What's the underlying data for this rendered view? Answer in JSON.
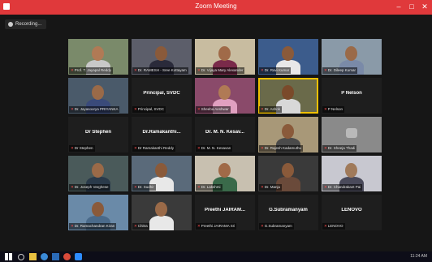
{
  "window": {
    "title": "Zoom Meeting"
  },
  "recording": {
    "label": "Recording..."
  },
  "tiles": [
    {
      "name": "Prof. T. Jayapal Reddy",
      "type": "video",
      "bg": "#7a8a6a",
      "skin": "#b07a55",
      "shirt": "#c8c8c8"
    },
    {
      "name": "Dr. RAMESH - Sree Kottayam",
      "type": "video",
      "bg": "#5c5e6a",
      "skin": "#8a5a3a",
      "shirt": "#2a2a3a"
    },
    {
      "name": "Dr. Vijaya Mary Alexander",
      "type": "video",
      "bg": "#c8bca0",
      "skin": "#a06a48",
      "shirt": "#7a2a4a"
    },
    {
      "name": "Dr. Ravi Kumar",
      "type": "video",
      "bg": "#3c5c8c",
      "skin": "#8a5a3a",
      "shirt": "#e8e8e8"
    },
    {
      "name": "Dr. Dileep Kumar",
      "type": "video",
      "bg": "#8a9aa8",
      "skin": "#9a6a48",
      "shirt": "#7a8aa8"
    },
    {
      "name": "Dr. Jayasoorya PRIYANKA",
      "type": "video",
      "bg": "#4a5a6a",
      "skin": "#9a6a48",
      "shirt": "#3a4a7a"
    },
    {
      "name": "Principal, SVDC",
      "type": "text",
      "big": "Principal, SVDC"
    },
    {
      "name": "Sheeba Aeshwar",
      "type": "video",
      "bg": "#8a4a6a",
      "skin": "#b07a55",
      "shirt": "#e0a0c0"
    },
    {
      "name": "Dr. Ashok",
      "type": "video",
      "bg": "#6a6a4a",
      "skin": "#7a4a2a",
      "shirt": "#d8d8d8",
      "active": true
    },
    {
      "name": "P Nelson",
      "type": "text",
      "big": "P Nelson"
    },
    {
      "name": "Dr Stephen",
      "type": "text",
      "big": "Dr Stephen"
    },
    {
      "name": "Dr Ramakanthi Reddy",
      "type": "text",
      "big": "Dr.Ramakanthi..."
    },
    {
      "name": "Dr. M. N. Kesavan",
      "type": "text",
      "big": "Dr. M. N. Kesav..."
    },
    {
      "name": "Dr. Rajesh Kadamuthu",
      "type": "video",
      "bg": "#a89878",
      "skin": "#8a5a3a",
      "shirt": "#4a4a4a"
    },
    {
      "name": "Dr. Sheeja Thadi",
      "type": "video",
      "bg": "#8a8a8a",
      "skin": "#8a8a8a",
      "shirt": "#8a8a8a",
      "plain": true
    },
    {
      "name": "Dr. Joseph Varghese",
      "type": "video",
      "bg": "#4a5a5a",
      "skin": "#9a6a48",
      "shirt": "#2a3a4a"
    },
    {
      "name": "Dr. Sudhir",
      "type": "video",
      "bg": "#5a6a7a",
      "skin": "#8a5a3a",
      "shirt": "#e8e8e8"
    },
    {
      "name": "Dr. Lakshmi",
      "type": "video",
      "bg": "#c8c0b0",
      "skin": "#a06a48",
      "shirt": "#3a6a4a"
    },
    {
      "name": "Dr. Manju",
      "type": "video",
      "bg": "#3a3a3a",
      "skin": "#8a5a3a",
      "shirt": "#6a4a3a"
    },
    {
      "name": "Dr. Chandrakant Pai",
      "type": "video",
      "bg": "#c8c8d0",
      "skin": "#a07a5a",
      "shirt": "#4a4a5a"
    },
    {
      "name": "Dr. Ramachandran Kiran",
      "type": "video",
      "bg": "#6a8aa8",
      "skin": "#8a5a3a",
      "shirt": "#4a6a8a"
    },
    {
      "name": "Chitra",
      "type": "video",
      "bg": "#3a3a3a",
      "skin": "#9a6a48",
      "shirt": "#e8e8e8"
    },
    {
      "name": "Preethi JAIRAMA Sri",
      "type": "text",
      "big": "Preethi JAIRAM..."
    },
    {
      "name": "G.Subramanyam",
      "type": "text",
      "big": "G.Subramanyam"
    },
    {
      "name": "LENOVO",
      "type": "text",
      "big": "LENOVO"
    }
  ],
  "taskbar": {
    "clock": "11:24 AM"
  },
  "colors": {
    "titlebar": "#e0393b",
    "active_speaker": "#f0c000",
    "muted": "#ff4d4d"
  }
}
